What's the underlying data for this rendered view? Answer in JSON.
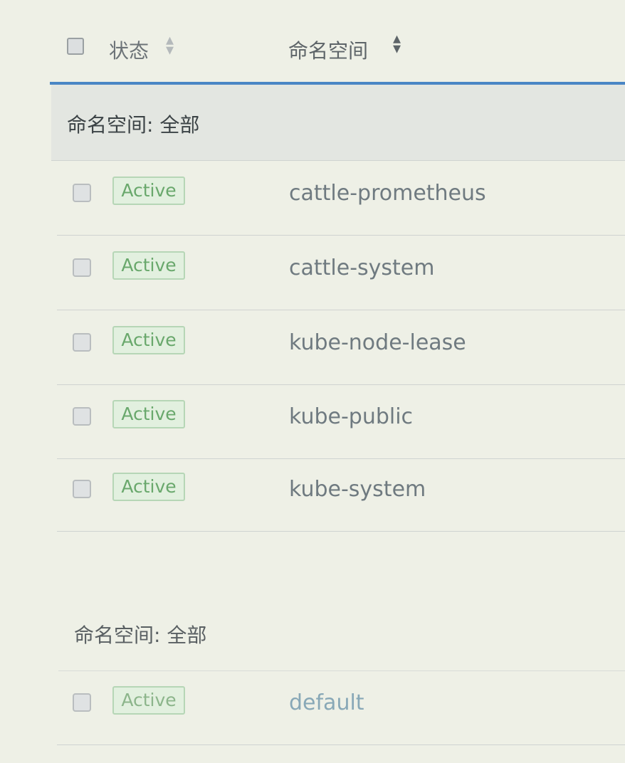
{
  "table": {
    "columns": [
      {
        "label": "状态",
        "sortable": true,
        "sort_icon": "sort-both-icon"
      },
      {
        "label": "命名空间",
        "sortable": true,
        "sort_icon": "sort-desc-icon"
      }
    ],
    "groups": [
      {
        "label": "命名空间: 全部",
        "rows": [
          {
            "status": "Active",
            "namespace": "cattle-prometheus"
          },
          {
            "status": "Active",
            "namespace": "cattle-system"
          },
          {
            "status": "Active",
            "namespace": "kube-node-lease"
          },
          {
            "status": "Active",
            "namespace": "kube-public"
          },
          {
            "status": "Active",
            "namespace": "kube-system"
          }
        ]
      },
      {
        "label": "命名空间: 全部",
        "rows": [
          {
            "status": "Active",
            "namespace": "default"
          }
        ]
      }
    ]
  },
  "colors": {
    "accent": "#4a86c5",
    "active_badge_bg": "#e2f0df",
    "active_badge_text": "#69a86c"
  }
}
